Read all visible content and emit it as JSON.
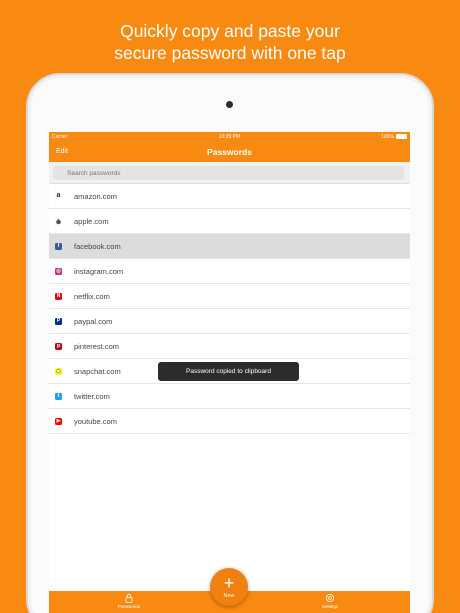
{
  "headline": {
    "line1": "Quickly copy and paste your",
    "line2": "secure password with one tap"
  },
  "status": {
    "carrier": "Carrier",
    "time": "10:29 PM",
    "battery": "100%"
  },
  "navbar": {
    "edit_label": "Edit",
    "title": "Passwords"
  },
  "search": {
    "placeholder": "Search passwords"
  },
  "items": [
    {
      "label": "amazon.com",
      "icon": "amazon-icon",
      "color": "#ffffff",
      "glyph": "a"
    },
    {
      "label": "apple.com",
      "icon": "apple-icon",
      "color": "#ffffff",
      "glyph": ""
    },
    {
      "label": "facebook.com",
      "icon": "facebook-icon",
      "color": "#3b5998",
      "glyph": "f"
    },
    {
      "label": "instagram.com",
      "icon": "instagram-icon",
      "color": "#c13584",
      "glyph": "◎"
    },
    {
      "label": "netflix.com",
      "icon": "netflix-icon",
      "color": "#e50914",
      "glyph": "N"
    },
    {
      "label": "paypal.com",
      "icon": "paypal-icon",
      "color": "#003087",
      "glyph": "P"
    },
    {
      "label": "pinterest.com",
      "icon": "pinterest-icon",
      "color": "#bd081c",
      "glyph": "p"
    },
    {
      "label": "snapchat.com",
      "icon": "snapchat-icon",
      "color": "#fffc00",
      "glyph": ""
    },
    {
      "label": "twitter.com",
      "icon": "twitter-icon",
      "color": "#1da1f2",
      "glyph": "t"
    },
    {
      "label": "youtube.com",
      "icon": "youtube-icon",
      "color": "#ff0000",
      "glyph": "▶"
    }
  ],
  "selected_index": 2,
  "toast": "Password copied to clipboard",
  "tabbar": {
    "passwords_label": "Passwords",
    "settings_label": "Settings",
    "new_label": "New"
  },
  "colors": {
    "accent": "#f88a12",
    "selected_row": "#dcdcdc"
  }
}
